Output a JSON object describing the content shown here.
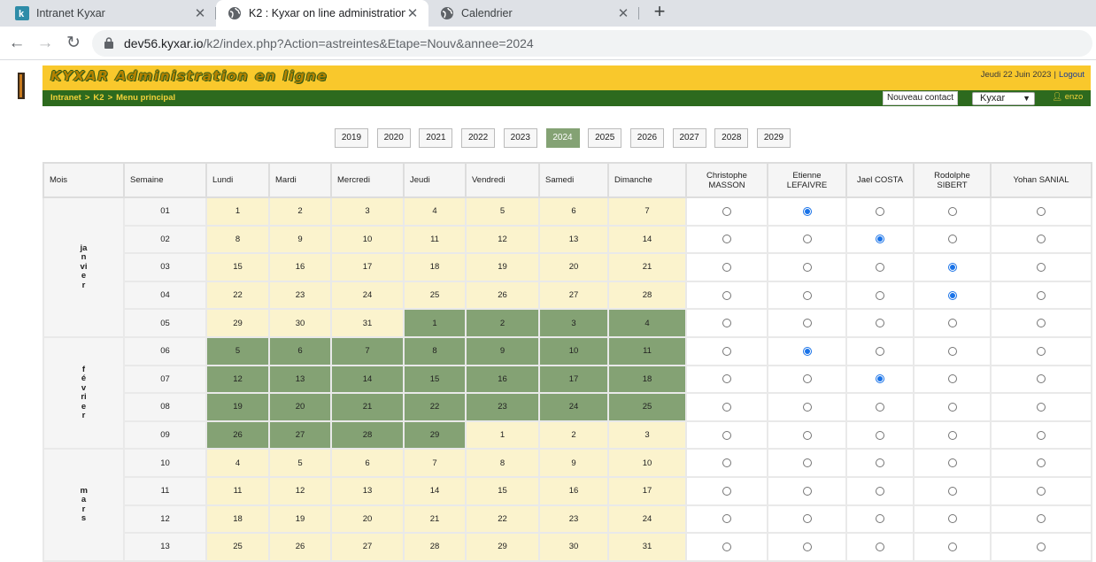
{
  "browser": {
    "tabs": [
      {
        "title": "Intranet Kyxar",
        "icon": "kyxar-favicon",
        "active": false
      },
      {
        "title": "K2 : Kyxar on line administration",
        "icon": "globe-icon",
        "active": true
      },
      {
        "title": "Calendrier",
        "icon": "globe-icon",
        "active": false
      }
    ],
    "url_host": "dev56.kyxar.io",
    "url_path": "/k2/index.php?Action=astreintes&Etape=Nouv&annee=2024"
  },
  "header": {
    "title": "KYXAR Administration en ligne",
    "date": "Jeudi 22 Juin 2023",
    "separator": "|",
    "logout": "Logout",
    "breadcrumb": [
      "Intranet",
      "K2",
      "Menu principal"
    ],
    "breadcrumb_sep": ">",
    "new_contact": "Nouveau contact",
    "company_select": "Kyxar",
    "user": "enzo"
  },
  "years": {
    "list": [
      "2019",
      "2020",
      "2021",
      "2022",
      "2023",
      "2024",
      "2025",
      "2026",
      "2027",
      "2028",
      "2029"
    ],
    "selected": "2024"
  },
  "table": {
    "headers": {
      "month": "Mois",
      "week": "Semaine"
    },
    "days": [
      "Lundi",
      "Mardi",
      "Mercredi",
      "Jeudi",
      "Vendredi",
      "Samedi",
      "Dimanche"
    ],
    "people": [
      {
        "first": "Christophe",
        "last": "MASSON"
      },
      {
        "first": "Etienne",
        "last": "LEFAIVRE"
      },
      {
        "first": "Jael COSTA",
        "last": ""
      },
      {
        "first": "Rodolphe",
        "last": "SIBERT"
      },
      {
        "first": "Yohan SANIAL",
        "last": ""
      }
    ],
    "months": [
      {
        "name": "janvier",
        "weeks": [
          {
            "week": "01",
            "days": [
              "1",
              "2",
              "3",
              "4",
              "5",
              "6",
              "7"
            ],
            "green": [
              0,
              0,
              0,
              0,
              0,
              0,
              0
            ],
            "assigned": 1
          },
          {
            "week": "02",
            "days": [
              "8",
              "9",
              "10",
              "11",
              "12",
              "13",
              "14"
            ],
            "green": [
              0,
              0,
              0,
              0,
              0,
              0,
              0
            ],
            "assigned": 2
          },
          {
            "week": "03",
            "days": [
              "15",
              "16",
              "17",
              "18",
              "19",
              "20",
              "21"
            ],
            "green": [
              0,
              0,
              0,
              0,
              0,
              0,
              0
            ],
            "assigned": 3
          },
          {
            "week": "04",
            "days": [
              "22",
              "23",
              "24",
              "25",
              "26",
              "27",
              "28"
            ],
            "green": [
              0,
              0,
              0,
              0,
              0,
              0,
              0
            ],
            "assigned": 3
          },
          {
            "week": "05",
            "days": [
              "29",
              "30",
              "31",
              "1",
              "2",
              "3",
              "4"
            ],
            "green": [
              0,
              0,
              0,
              1,
              1,
              1,
              1
            ],
            "assigned": -1
          }
        ]
      },
      {
        "name": "février",
        "weeks": [
          {
            "week": "06",
            "days": [
              "5",
              "6",
              "7",
              "8",
              "9",
              "10",
              "11"
            ],
            "green": [
              1,
              1,
              1,
              1,
              1,
              1,
              1
            ],
            "assigned": 1
          },
          {
            "week": "07",
            "days": [
              "12",
              "13",
              "14",
              "15",
              "16",
              "17",
              "18"
            ],
            "green": [
              1,
              1,
              1,
              1,
              1,
              1,
              1
            ],
            "assigned": 2
          },
          {
            "week": "08",
            "days": [
              "19",
              "20",
              "21",
              "22",
              "23",
              "24",
              "25"
            ],
            "green": [
              1,
              1,
              1,
              1,
              1,
              1,
              1
            ],
            "assigned": -1
          },
          {
            "week": "09",
            "days": [
              "26",
              "27",
              "28",
              "29",
              "1",
              "2",
              "3"
            ],
            "green": [
              1,
              1,
              1,
              1,
              0,
              0,
              0
            ],
            "assigned": -1
          }
        ]
      },
      {
        "name": "mars",
        "weeks": [
          {
            "week": "10",
            "days": [
              "4",
              "5",
              "6",
              "7",
              "8",
              "9",
              "10"
            ],
            "green": [
              0,
              0,
              0,
              0,
              0,
              0,
              0
            ],
            "assigned": -1
          },
          {
            "week": "11",
            "days": [
              "11",
              "12",
              "13",
              "14",
              "15",
              "16",
              "17"
            ],
            "green": [
              0,
              0,
              0,
              0,
              0,
              0,
              0
            ],
            "assigned": -1
          },
          {
            "week": "12",
            "days": [
              "18",
              "19",
              "20",
              "21",
              "22",
              "23",
              "24"
            ],
            "green": [
              0,
              0,
              0,
              0,
              0,
              0,
              0
            ],
            "assigned": -1
          },
          {
            "week": "13",
            "days": [
              "25",
              "26",
              "27",
              "28",
              "29",
              "30",
              "31"
            ],
            "green": [
              0,
              0,
              0,
              0,
              0,
              0,
              0
            ],
            "assigned": -1
          }
        ]
      }
    ]
  },
  "colors": {
    "header_yellow": "#f9c82c",
    "header_green": "#2d6a1e",
    "day_cream": "#fbf3cd",
    "day_green": "#84a274",
    "radio_blue": "#1a73e8"
  }
}
